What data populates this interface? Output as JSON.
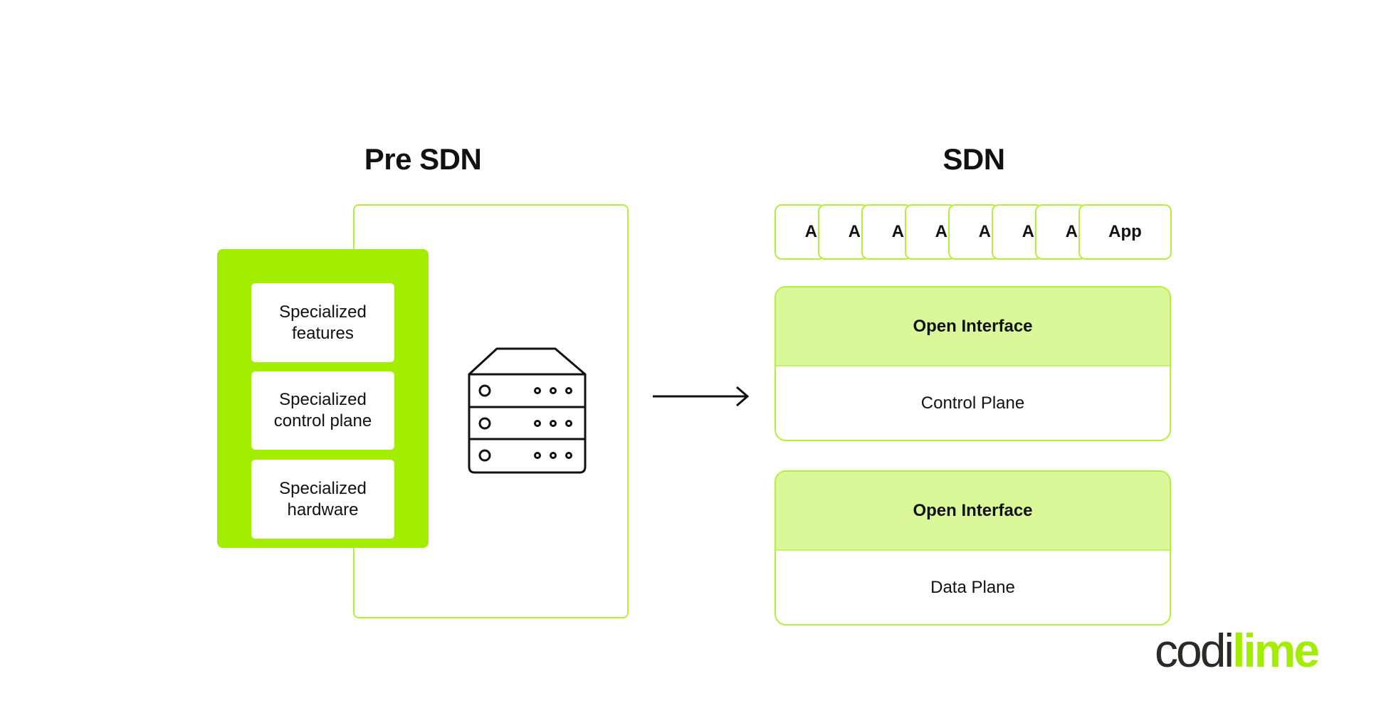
{
  "pre_sdn": {
    "title": "Pre SDN",
    "stack": [
      {
        "line1": "Specialized",
        "line2": "features"
      },
      {
        "line1": "Specialized",
        "line2": "control plane"
      },
      {
        "line1": "Specialized",
        "line2": "hardware"
      }
    ],
    "icon": "server-rack-icon"
  },
  "transition": {
    "icon": "arrow-right-icon"
  },
  "sdn": {
    "title": "SDN",
    "apps": [
      "A",
      "A",
      "A",
      "A",
      "A",
      "A",
      "A",
      "App"
    ],
    "layers": [
      {
        "interface": "Open Interface",
        "plane": "Control Plane"
      },
      {
        "interface": "Open Interface",
        "plane": "Data Plane"
      }
    ]
  },
  "logo": {
    "part1": "codi",
    "part2": "lime"
  },
  "colors": {
    "accent_green": "#a3ee00",
    "light_green": "#daf79a",
    "outline_green": "#b4ef3a",
    "text_dark": "#111111",
    "logo_dark": "#2b2a28"
  }
}
